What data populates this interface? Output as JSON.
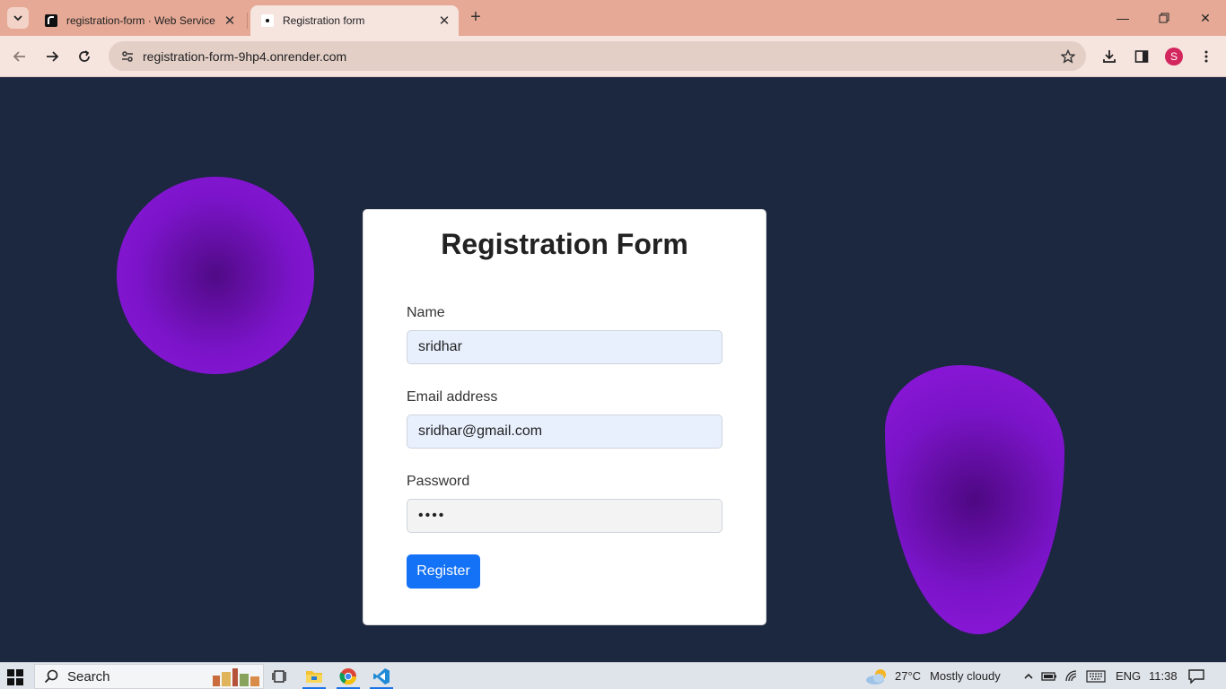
{
  "browser": {
    "tabs": [
      {
        "title": "registration-form · Web Service",
        "active": false
      },
      {
        "title": "Registration form",
        "active": true
      }
    ],
    "url": "registration-form-9hp4.onrender.com",
    "profile_initial": "S"
  },
  "form": {
    "title": "Registration Form",
    "name_label": "Name",
    "name_value": "sridhar",
    "email_label": "Email address",
    "email_value": "sridhar@gmail.com",
    "password_label": "Password",
    "password_value": "••••",
    "submit_label": "Register"
  },
  "taskbar": {
    "search_label": "Search",
    "weather_temp": "27°C",
    "weather_desc": "Mostly cloudy",
    "language": "ENG",
    "time": "11:38"
  },
  "colors": {
    "page_background": "#1c2740",
    "blob": "#8f17dc",
    "button": "#1472f6",
    "tabbar": "#e5a996"
  }
}
